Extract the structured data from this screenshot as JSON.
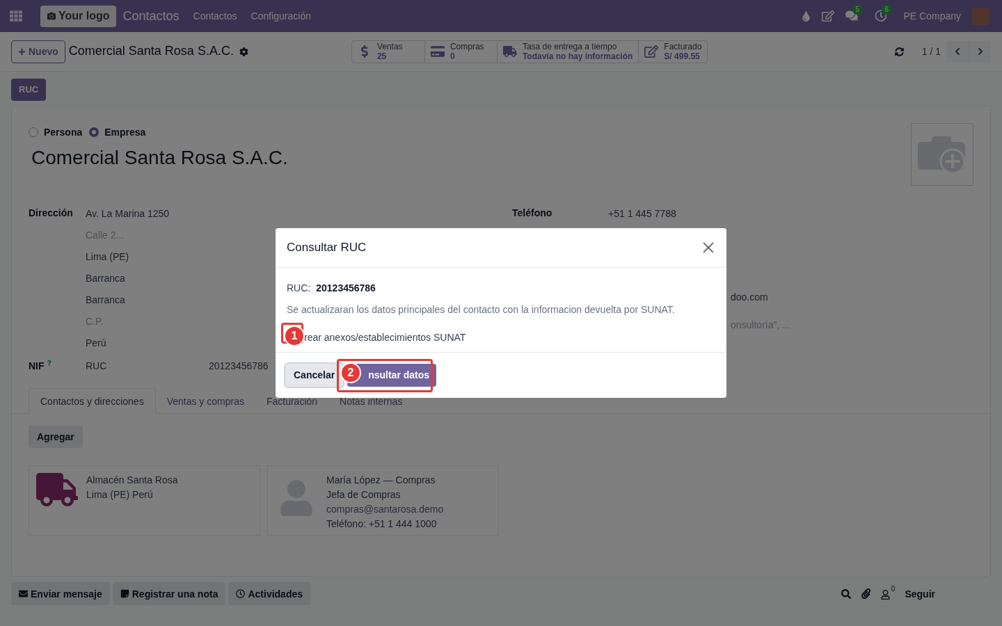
{
  "navbar": {
    "logo": "Your logo",
    "app": "Contactos",
    "menu": [
      "Contactos",
      "Configuración"
    ],
    "badges": [
      {
        "kind": "chat",
        "count": "5"
      },
      {
        "kind": "activity",
        "count": "6"
      }
    ],
    "company": "PE Company"
  },
  "control_panel": {
    "new_button": "Nuevo",
    "breadcrumb": "Comercial Santa Rosa S.A.C.",
    "stats": [
      {
        "kind": "sales",
        "label": "Ventas",
        "value": "25"
      },
      {
        "kind": "purchases",
        "label": "Compras",
        "value": "0"
      },
      {
        "kind": "delivery",
        "label": "Tasa de entrega a tiempo",
        "value": "Todavía no hay información"
      },
      {
        "kind": "invoiced",
        "label": "Facturado",
        "value": "S/ 499.55"
      }
    ],
    "pager": "1 / 1"
  },
  "form": {
    "status_button": "RUC",
    "company_type": [
      {
        "label": "Persona",
        "selected": false
      },
      {
        "label": "Empresa",
        "selected": true
      }
    ],
    "name": "Comercial Santa Rosa S.A.C.",
    "address_label": "Dirección",
    "address": [
      {
        "text": "Av. La Marina 1250",
        "kind": "value"
      },
      {
        "text": "Calle 2...",
        "kind": "placeholder"
      },
      {
        "text": "Lima (PE)",
        "kind": "value"
      },
      {
        "text": "Barranca",
        "kind": "value"
      },
      {
        "text": "Barranca",
        "kind": "value"
      },
      {
        "text": "C.P.",
        "kind": "placeholder"
      },
      {
        "text": "Perú",
        "kind": "value"
      }
    ],
    "nif_label": "NIF",
    "nif_help": "?",
    "nif_type": "RUC",
    "nif_value": "20123456786",
    "phone_label": "Teléfono",
    "phone_value": "+51 1 445 7788",
    "partial_values": [
      {
        "text": "doo.com",
        "kind": "value"
      },
      {
        "text": "onsultoría\", ...",
        "kind": "placeholder"
      }
    ],
    "tabs": [
      {
        "label": "Contactos y direcciones",
        "selected": true
      },
      {
        "label": "Ventas y compras",
        "selected": false
      },
      {
        "label": "Facturación",
        "selected": false
      },
      {
        "label": "Notas internas",
        "selected": false
      }
    ],
    "add_button": "Agregar",
    "cards": [
      {
        "kind": "delivery",
        "lines": [
          "Almacén Santa Rosa",
          "Lima (PE) Perú"
        ]
      },
      {
        "kind": "contact",
        "lines": [
          "María López — Compras",
          "Jefa de Compras"
        ],
        "email": "compras@santarosa.demo",
        "phone": "Teléfono: +51 1 444 1000"
      }
    ]
  },
  "chatter": {
    "buttons": [
      {
        "kind": "message",
        "label": "Enviar mensaje"
      },
      {
        "kind": "note",
        "label": "Registrar una nota"
      },
      {
        "kind": "activity",
        "label": "Actividades"
      }
    ],
    "followers": "0",
    "follow": "Seguir"
  },
  "dialog": {
    "title": "Consultar RUC",
    "ruc_label": "RUC:",
    "ruc_value": "20123456786",
    "message": "Se actualizaran los datos principales del contacto con la informacion devuelta por SUNAT.",
    "checkbox": {
      "label": "rear anexos/establecimientos SUNAT"
    },
    "cancel": "Cancelar",
    "confirm": "nsultar datos"
  },
  "annotations": [
    {
      "number": "1"
    },
    {
      "number": "2"
    }
  ]
}
